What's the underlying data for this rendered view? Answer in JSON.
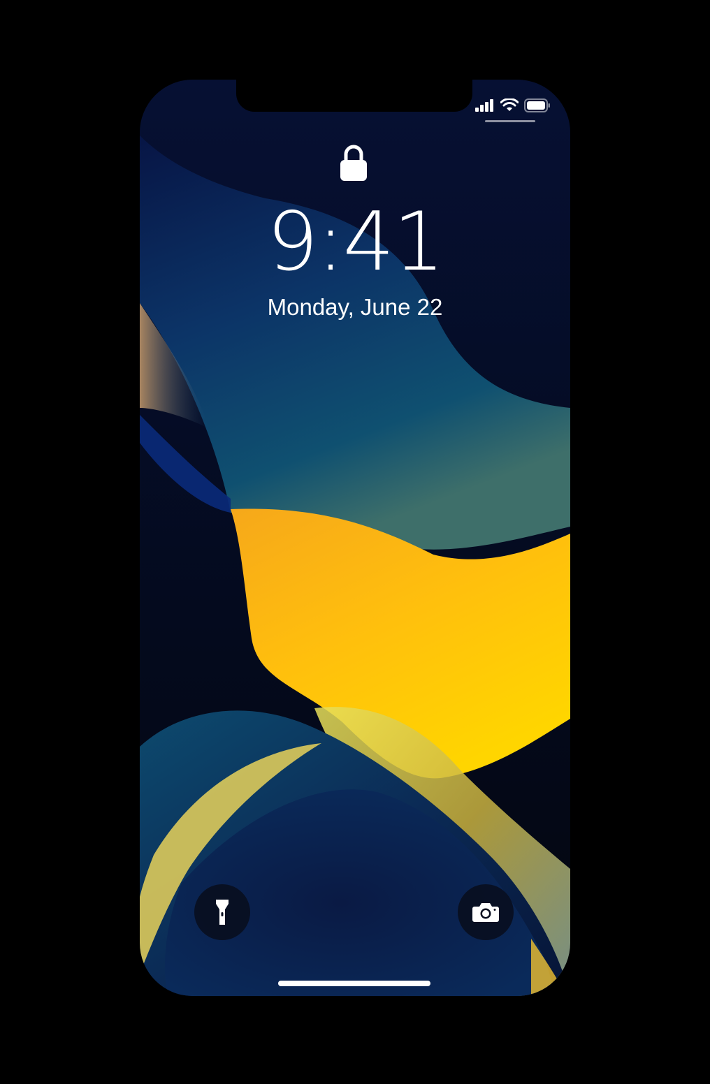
{
  "lock_screen": {
    "time": "9:41",
    "date": "Monday, June 22"
  },
  "status_bar": {
    "icons": [
      "cellular-signal-icon",
      "wifi-icon",
      "battery-icon"
    ]
  },
  "quick_actions": {
    "left": "flashlight-icon",
    "right": "camera-icon"
  },
  "colors": {
    "background": "#000000",
    "wallpaper_dark": "#050c22",
    "wallpaper_blue": "#0d3a6b",
    "wallpaper_yellow": "#ffc20a",
    "foreground": "#ffffff"
  }
}
